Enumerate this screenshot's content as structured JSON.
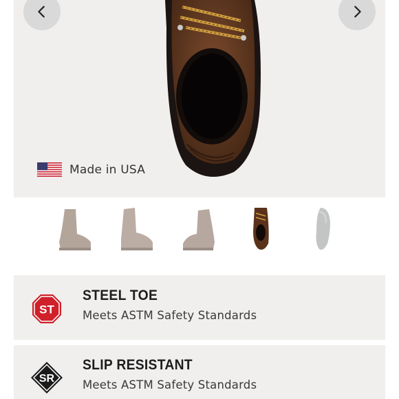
{
  "gallery": {
    "made_in_label": "Made in USA",
    "active_thumbnail": 4,
    "thumbnails": [
      {
        "view": "side-angle"
      },
      {
        "view": "side-profile"
      },
      {
        "view": "side-angle-reverse"
      },
      {
        "view": "top-down"
      },
      {
        "view": "outsole"
      }
    ]
  },
  "features": [
    {
      "badge": "ST",
      "badge_shape": "octagon",
      "badge_color": "#d0202a",
      "title": "STEEL TOE",
      "description": "Meets ASTM Safety Standards"
    },
    {
      "badge": "SR",
      "badge_shape": "diamond",
      "badge_color": "#1a1a1a",
      "title": "SLIP RESISTANT",
      "description": "Meets ASTM Safety Standards"
    }
  ]
}
